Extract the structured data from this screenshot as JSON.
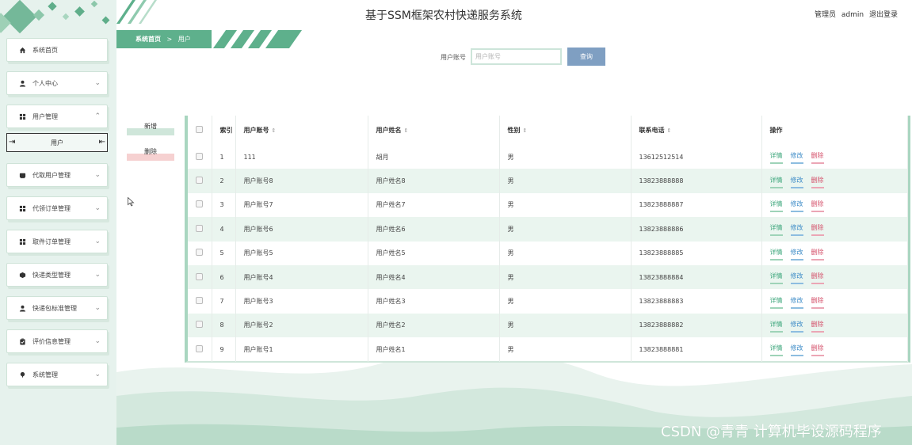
{
  "header": {
    "title": "基于SSM框架农村快递服务系统",
    "role": "管理员",
    "username": "admin",
    "logout": "退出登录"
  },
  "breadcrumb": {
    "home": "系统首页",
    "separator": ">",
    "current": "用户"
  },
  "sidebar": {
    "items": [
      {
        "label": "系统首页",
        "icon": "home-icon"
      },
      {
        "label": "个人中心",
        "icon": "person-icon"
      },
      {
        "label": "用户管理",
        "icon": "grid-icon"
      },
      {
        "label": "代取用户管理",
        "icon": "inbox-icon"
      },
      {
        "label": "代领订单管理",
        "icon": "grid-icon"
      },
      {
        "label": "取件订单管理",
        "icon": "grid-icon"
      },
      {
        "label": "快递类型管理",
        "icon": "package-icon"
      },
      {
        "label": "快递包标准管理",
        "icon": "person-icon"
      },
      {
        "label": "评价信息管理",
        "icon": "clipboard-icon"
      },
      {
        "label": "系统管理",
        "icon": "pin-icon"
      }
    ],
    "submenu": {
      "label": "用户"
    }
  },
  "search": {
    "label": "用户账号",
    "placeholder": "用户账号",
    "button": "查询"
  },
  "actions": {
    "add": "新增",
    "delete": "删除"
  },
  "table": {
    "columns": {
      "index": "索引",
      "account": "用户账号",
      "name": "用户姓名",
      "gender": "性别",
      "phone": "联系电话",
      "ops": "操作"
    },
    "op_labels": {
      "detail": "详情",
      "edit": "修改",
      "delete": "删除"
    },
    "rows": [
      {
        "index": "1",
        "account": "111",
        "name": "胡月",
        "gender": "男",
        "phone": "13612512514"
      },
      {
        "index": "2",
        "account": "用户账号8",
        "name": "用户姓名8",
        "gender": "男",
        "phone": "13823888888"
      },
      {
        "index": "3",
        "account": "用户账号7",
        "name": "用户姓名7",
        "gender": "男",
        "phone": "13823888887"
      },
      {
        "index": "4",
        "account": "用户账号6",
        "name": "用户姓名6",
        "gender": "男",
        "phone": "13823888886"
      },
      {
        "index": "5",
        "account": "用户账号5",
        "name": "用户姓名5",
        "gender": "男",
        "phone": "13823888885"
      },
      {
        "index": "6",
        "account": "用户账号4",
        "name": "用户姓名4",
        "gender": "男",
        "phone": "13823888884"
      },
      {
        "index": "7",
        "account": "用户账号3",
        "name": "用户姓名3",
        "gender": "男",
        "phone": "13823888883"
      },
      {
        "index": "8",
        "account": "用户账号2",
        "name": "用户姓名2",
        "gender": "男",
        "phone": "13823888882"
      },
      {
        "index": "9",
        "account": "用户账号1",
        "name": "用户姓名1",
        "gender": "男",
        "phone": "13823888881"
      }
    ]
  },
  "watermark": "CSDN @青青  计算机毕设源码程序",
  "colors": {
    "accent": "#5eb08c",
    "sidebar_bg": "#e6f2ed",
    "row_alt": "#eaf5ef",
    "search_button": "#7f9fc2",
    "op_detail": "#3aa57a",
    "op_edit": "#3c8bc7",
    "op_delete": "#d4506a"
  }
}
